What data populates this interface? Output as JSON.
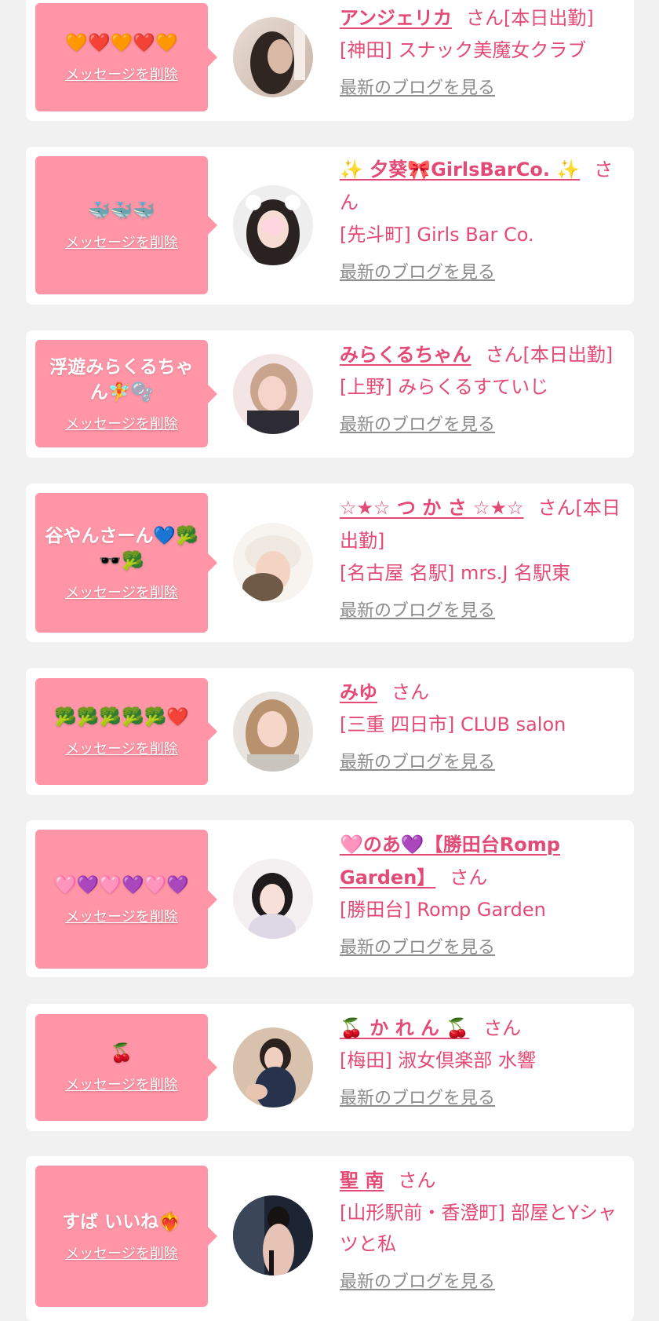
{
  "delete_label": "メッセージを削除",
  "blog_label": "最新のブログを見る",
  "san_label": "さん",
  "colors": {
    "bubble": "#ff95a6",
    "accent": "#e34a75",
    "link_gray": "#8c8c8c",
    "background": "#f1f1f1"
  },
  "entries": [
    {
      "message": "🧡❤️🧡❤️🧡",
      "name": "アンジェリカ",
      "suffix": "さん[本日出勤]",
      "shop": "[神田] スナック美魔女クラブ"
    },
    {
      "message": "🐳🐳🐳",
      "name": "✨ 夕葵🎀GirlsBarCo. ✨",
      "suffix": "さん",
      "shop": "[先斗町] Girls Bar Co."
    },
    {
      "message": "浮遊みらくるちゃん🧚🫧",
      "name": "みらくるちゃん",
      "suffix": "さん[本日出勤]",
      "shop": "[上野] みらくるすていじ"
    },
    {
      "message": "谷やんさーん💙🥦🕶️🥦",
      "name": "☆★☆ つ か さ ☆★☆",
      "suffix": "さん[本日出勤]",
      "shop": "[名古屋 名駅] mrs.J 名駅東"
    },
    {
      "message": "🥦🥦🥦🥦🥦❤️",
      "name": "みゆ",
      "suffix": "さん",
      "shop": "[三重 四日市] CLUB salon"
    },
    {
      "message": "🩷💜🩷💜🩷💜",
      "name": "🩷のあ💜【勝田台Romp Garden】",
      "suffix": "さん",
      "shop": "[勝田台] Romp Garden"
    },
    {
      "message": "🍒",
      "name": "🍒 か れ ん 🍒",
      "suffix": "さん",
      "shop": "[梅田] 淑女倶楽部 水響"
    },
    {
      "message": "すば いいね❤️‍🔥",
      "name": "聖 南",
      "suffix": "さん",
      "shop": "[山形駅前・香澄町] 部屋とYシャツと私"
    }
  ]
}
